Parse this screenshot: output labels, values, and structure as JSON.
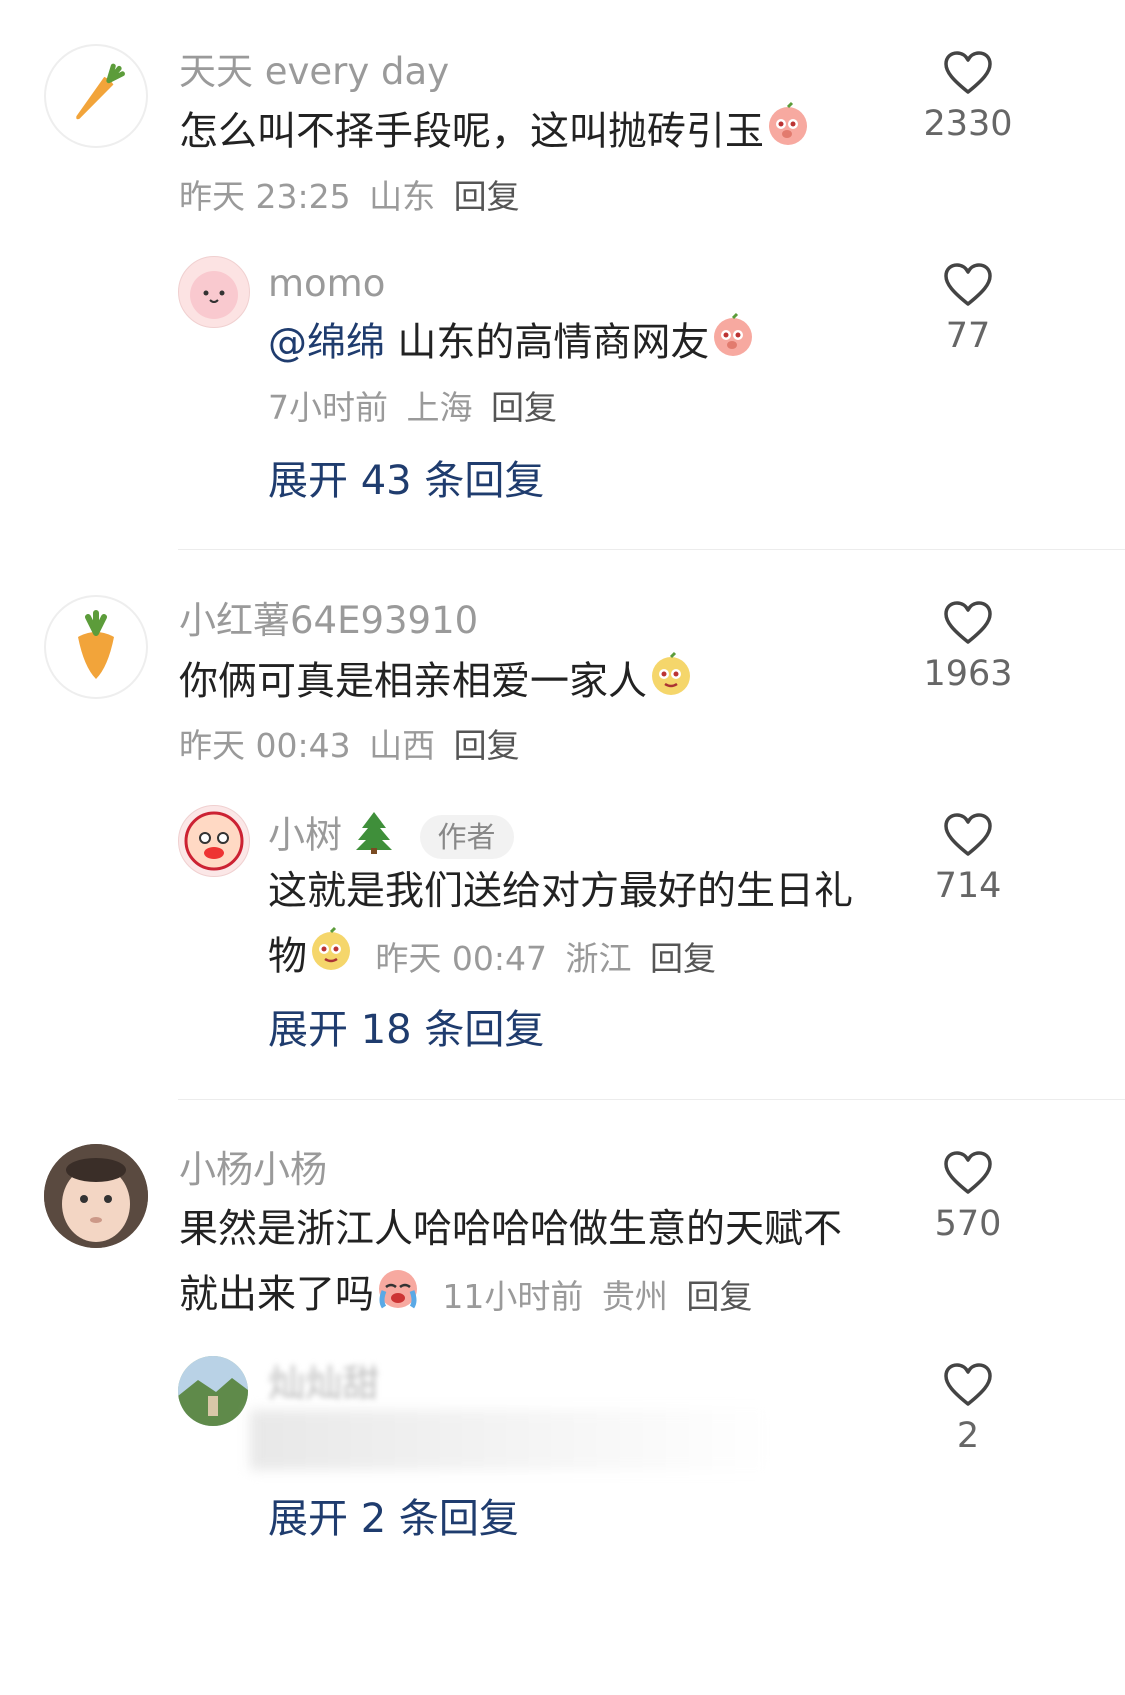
{
  "comments": [
    {
      "username": "天天 every day",
      "content": "怎么叫不择手段呢，这叫抛砖引玉",
      "time": "昨天 23:25",
      "location": "山东",
      "reply_label": "回复",
      "likes": "2330",
      "replies": [
        {
          "username": "momo",
          "mention": "@绵绵",
          "content": "山东的高情商网友",
          "time": "7小时前",
          "location": "上海",
          "reply_label": "回复",
          "likes": "77"
        }
      ],
      "expand_label": "展开 43 条回复"
    },
    {
      "username": "小红薯64E93910",
      "content": "你俩可真是相亲相爱一家人",
      "time": "昨天 00:43",
      "location": "山西",
      "reply_label": "回复",
      "likes": "1963",
      "replies": [
        {
          "username": "小树",
          "badge": "作者",
          "content_line1": "这就是我们送给对方最好的生日礼",
          "content_line2": "物",
          "time": "昨天 00:47",
          "location": "浙江",
          "reply_label": "回复",
          "likes": "714"
        }
      ],
      "expand_label": "展开 18 条回复"
    },
    {
      "username": "小杨小杨",
      "content_line1": "果然是浙江人哈哈哈哈做生意的天赋不",
      "content_line2": "就出来了吗",
      "time": "11小时前",
      "location": "贵州",
      "reply_label": "回复",
      "likes": "570",
      "replies": [
        {
          "username": "灿灿甜",
          "likes": "2"
        }
      ],
      "expand_label": "展开 2 条回复"
    }
  ],
  "icons": {
    "like": "heart-outline-icon",
    "emoji": "peach-emoji-icon"
  },
  "colors": {
    "link": "#1f3c6e",
    "muted": "#9a9a9a",
    "text": "#222222"
  }
}
